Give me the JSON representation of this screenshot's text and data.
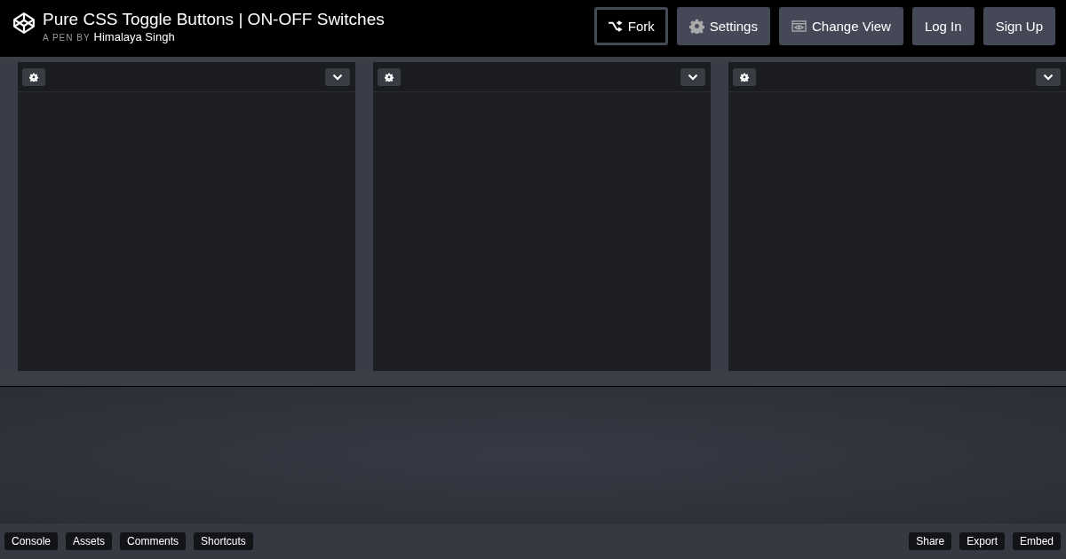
{
  "header": {
    "title": "Pure CSS Toggle Buttons | ON-OFF Switches",
    "byline": "A PEN BY",
    "author": "Himalaya Singh",
    "buttons": [
      {
        "label": "Fork",
        "kind": "fork"
      },
      {
        "label": "Settings",
        "kind": "settings"
      },
      {
        "label": "Change View",
        "kind": "view"
      },
      {
        "label": "Log In",
        "kind": "plain"
      },
      {
        "label": "Sign Up",
        "kind": "plain"
      }
    ]
  },
  "footer": {
    "left": [
      "Console",
      "Assets",
      "Comments",
      "Shortcuts"
    ],
    "right": [
      "Share",
      "Export",
      "Embed"
    ]
  }
}
